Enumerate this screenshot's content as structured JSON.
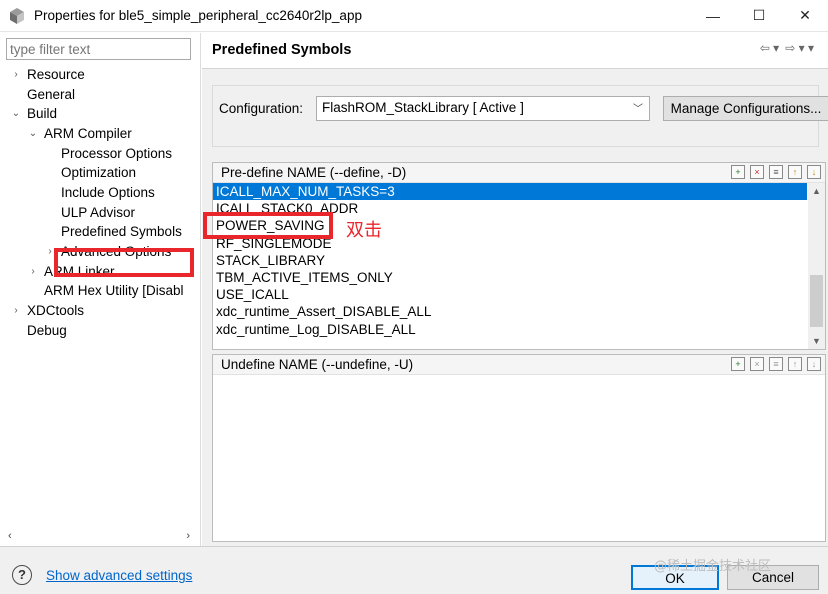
{
  "window": {
    "title": "Properties for ble5_simple_peripheral_cc2640r2lp_app",
    "minimize": "—",
    "maximize": "☐",
    "close": "✕"
  },
  "left": {
    "filter_placeholder": "type filter text",
    "tree": [
      {
        "label": "Resource",
        "arrow": "›"
      },
      {
        "label": "General",
        "arrow": ""
      },
      {
        "label": "Build",
        "arrow": "⌄"
      },
      {
        "label": "ARM Compiler",
        "arrow": "⌄"
      },
      {
        "label": "Processor Options",
        "arrow": ""
      },
      {
        "label": "Optimization",
        "arrow": ""
      },
      {
        "label": "Include Options",
        "arrow": ""
      },
      {
        "label": "ULP Advisor",
        "arrow": ""
      },
      {
        "label": "Predefined Symbols",
        "arrow": ""
      },
      {
        "label": "Advanced Options",
        "arrow": "›"
      },
      {
        "label": "ARM Linker",
        "arrow": "›"
      },
      {
        "label": "ARM Hex Utility  [Disabl",
        "arrow": ""
      },
      {
        "label": "XDCtools",
        "arrow": "›"
      },
      {
        "label": "Debug",
        "arrow": ""
      }
    ],
    "scroll_left": "‹",
    "scroll_right": "›"
  },
  "page": {
    "title": "Predefined Symbols",
    "nav_back": "⇦ ▾",
    "nav_forward": "⇨ ▾ ▾"
  },
  "config": {
    "label": "Configuration:",
    "value": "FlashROM_StackLibrary  [ Active ]",
    "chevron": "﹀",
    "manage_label": "Manage Configurations..."
  },
  "predefine": {
    "header": "Pre-define NAME (--define, -D)",
    "items": [
      "ICALL_MAX_NUM_TASKS=3",
      "ICALL_STACK0_ADDR",
      "POWER_SAVING",
      "RF_SINGLEMODE",
      "STACK_LIBRARY",
      "TBM_ACTIVE_ITEMS_ONLY",
      "USE_ICALL",
      "xdc_runtime_Assert_DISABLE_ALL",
      "xdc_runtime_Log_DISABLE_ALL"
    ],
    "selected_index": 0
  },
  "undefine": {
    "header": "Undefine NAME (--undefine, -U)"
  },
  "annotation": "双击",
  "bottom": {
    "help": "?",
    "advanced_link": "Show advanced settings",
    "ok_label": "OK",
    "cancel_label": "Cancel",
    "watermark": "@稀土掘金技术社区"
  },
  "colors": {
    "accent": "#0078d7",
    "highlight_box": "#e8262b",
    "link": "#0066cc"
  }
}
